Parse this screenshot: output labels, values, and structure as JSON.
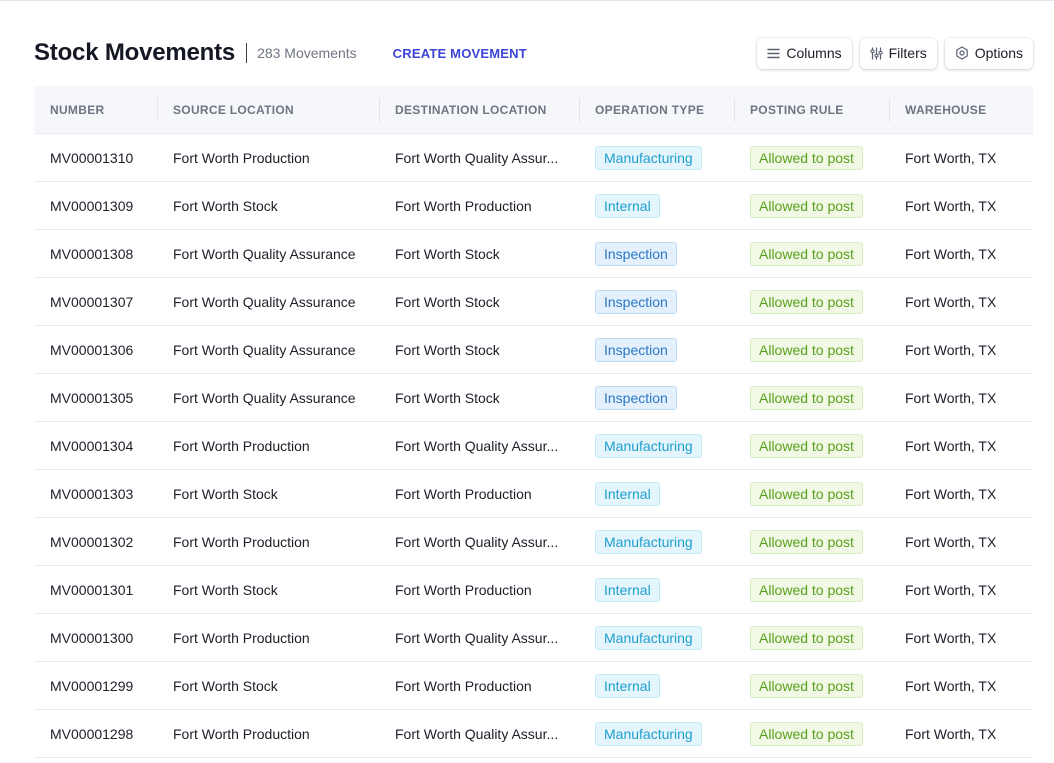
{
  "page": {
    "title": "Stock Movements",
    "count": "283 Movements",
    "create_label": "CREATE MOVEMENT"
  },
  "toolbar": {
    "columns_label": "Columns",
    "filters_label": "Filters",
    "options_label": "Options"
  },
  "table": {
    "headers": [
      "NUMBER",
      "SOURCE LOCATION",
      "DESTINATION LOCATION",
      "OPERATION TYPE",
      "POSTING RULE",
      "WAREHOUSE"
    ],
    "rows": [
      {
        "number": "MV00001310",
        "source": "Fort Worth Production",
        "destination": "Fort Worth Quality Assur...",
        "operation": "Manufacturing",
        "posting": "Allowed to post",
        "warehouse": "Fort Worth, TX"
      },
      {
        "number": "MV00001309",
        "source": "Fort Worth Stock",
        "destination": "Fort Worth Production",
        "operation": "Internal",
        "posting": "Allowed to post",
        "warehouse": "Fort Worth, TX"
      },
      {
        "number": "MV00001308",
        "source": "Fort Worth Quality Assurance",
        "destination": "Fort Worth Stock",
        "operation": "Inspection",
        "posting": "Allowed to post",
        "warehouse": "Fort Worth, TX"
      },
      {
        "number": "MV00001307",
        "source": "Fort Worth Quality Assurance",
        "destination": "Fort Worth Stock",
        "operation": "Inspection",
        "posting": "Allowed to post",
        "warehouse": "Fort Worth, TX"
      },
      {
        "number": "MV00001306",
        "source": "Fort Worth Quality Assurance",
        "destination": "Fort Worth Stock",
        "operation": "Inspection",
        "posting": "Allowed to post",
        "warehouse": "Fort Worth, TX"
      },
      {
        "number": "MV00001305",
        "source": "Fort Worth Quality Assurance",
        "destination": "Fort Worth Stock",
        "operation": "Inspection",
        "posting": "Allowed to post",
        "warehouse": "Fort Worth, TX"
      },
      {
        "number": "MV00001304",
        "source": "Fort Worth Production",
        "destination": "Fort Worth Quality Assur...",
        "operation": "Manufacturing",
        "posting": "Allowed to post",
        "warehouse": "Fort Worth, TX"
      },
      {
        "number": "MV00001303",
        "source": "Fort Worth Stock",
        "destination": "Fort Worth Production",
        "operation": "Internal",
        "posting": "Allowed to post",
        "warehouse": "Fort Worth, TX"
      },
      {
        "number": "MV00001302",
        "source": "Fort Worth Production",
        "destination": "Fort Worth Quality Assur...",
        "operation": "Manufacturing",
        "posting": "Allowed to post",
        "warehouse": "Fort Worth, TX"
      },
      {
        "number": "MV00001301",
        "source": "Fort Worth Stock",
        "destination": "Fort Worth Production",
        "operation": "Internal",
        "posting": "Allowed to post",
        "warehouse": "Fort Worth, TX"
      },
      {
        "number": "MV00001300",
        "source": "Fort Worth Production",
        "destination": "Fort Worth Quality Assur...",
        "operation": "Manufacturing",
        "posting": "Allowed to post",
        "warehouse": "Fort Worth, TX"
      },
      {
        "number": "MV00001299",
        "source": "Fort Worth Stock",
        "destination": "Fort Worth Production",
        "operation": "Internal",
        "posting": "Allowed to post",
        "warehouse": "Fort Worth, TX"
      },
      {
        "number": "MV00001298",
        "source": "Fort Worth Production",
        "destination": "Fort Worth Quality Assur...",
        "operation": "Manufacturing",
        "posting": "Allowed to post",
        "warehouse": "Fort Worth, TX"
      }
    ]
  },
  "icons": {
    "columns": "list-lines-icon",
    "filters": "sliders-icon",
    "options": "hexagon-gear-icon"
  },
  "colors": {
    "accent": "#3d45d9",
    "operation_badge": "#1f9fcf",
    "inspection_badge": "#2a78c8",
    "posting_badge": "#58a01c"
  }
}
